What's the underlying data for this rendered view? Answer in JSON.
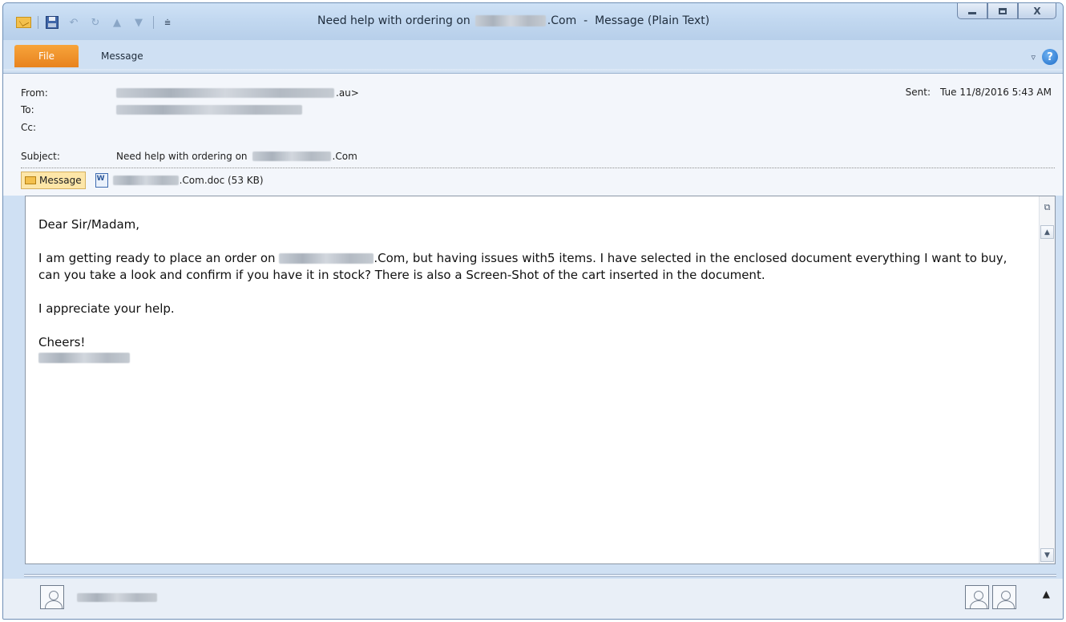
{
  "window": {
    "title_prefix": "Need help with ordering on",
    "title_suffix": ".Com  -  Message (Plain Text)",
    "controls": {
      "close_glyph": "X"
    }
  },
  "qat": {
    "icons": [
      "mail-icon",
      "save-icon",
      "undo-icon",
      "redo-icon",
      "previous-icon",
      "next-icon",
      "customize-icon"
    ]
  },
  "ribbon": {
    "file_tab": "File",
    "message_tab": "Message",
    "help_glyph": "?"
  },
  "header": {
    "from_label": "From:",
    "from_suffix": ".au>",
    "to_label": "To:",
    "cc_label": "Cc:",
    "subject_label": "Subject:",
    "subject_prefix": "Need help with ordering on",
    "subject_suffix": ".Com",
    "sent_label": "Sent:",
    "sent_value": "Tue 11/8/2016 5:43 AM"
  },
  "attachments": {
    "message_tab": "Message",
    "file_suffix": ".Com.doc (53 KB)"
  },
  "body": {
    "greeting": "Dear Sir/Madam,",
    "para1_prefix": "I am getting ready to place an order on",
    "para1_suffix": ".Com, but having issues with5 items. I have selected in the enclosed document everything I want to buy, can you take a look and confirm if you have it in stock? There is also a Screen-Shot of the cart inserted in the document.",
    "para2": "I appreciate your help.",
    "closing": "Cheers!"
  }
}
